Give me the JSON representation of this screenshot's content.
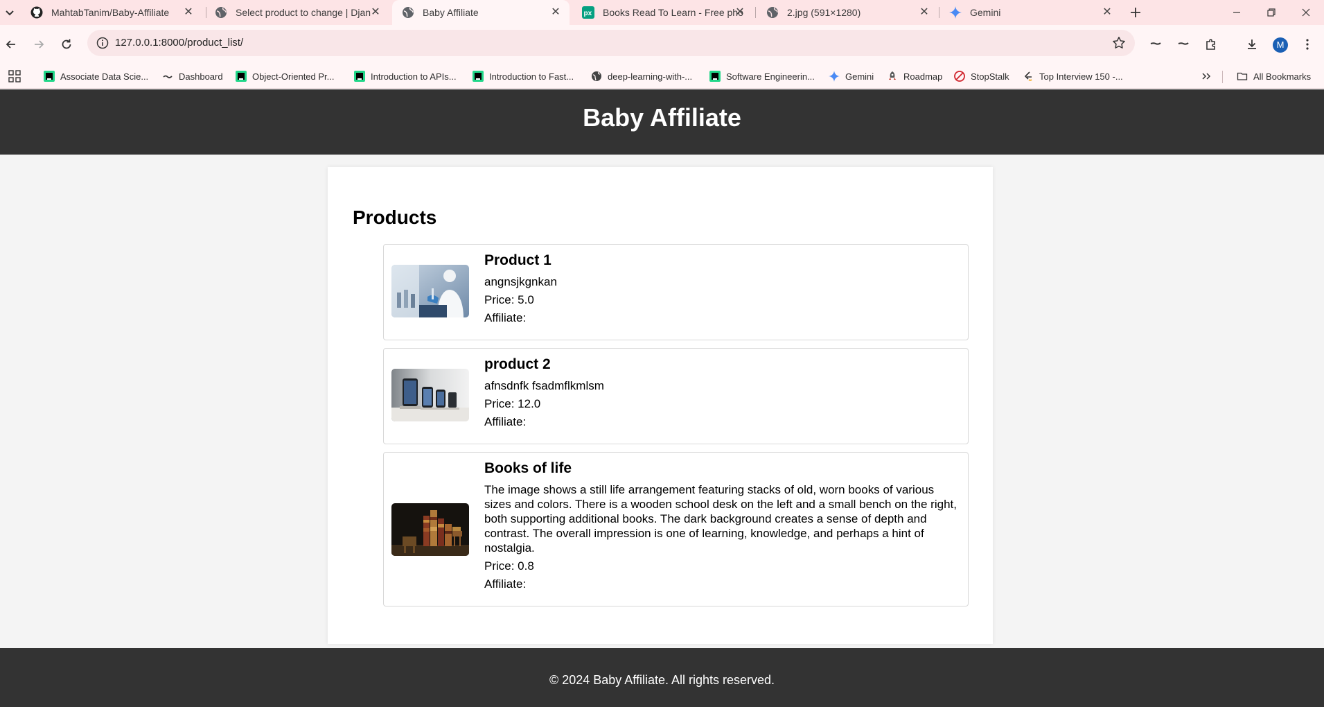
{
  "browser": {
    "tabs": [
      {
        "title": "MahtabTanim/Baby-Affiliate",
        "icon": "github-icon",
        "active": false
      },
      {
        "title": "Select product to change | Djan",
        "icon": "globe-icon",
        "active": false
      },
      {
        "title": "Baby Affiliate",
        "icon": "globe-icon",
        "active": true
      },
      {
        "title": "Books Read To Learn - Free pho",
        "icon": "pexels-icon",
        "active": false
      },
      {
        "title": "2.jpg (591×1280)",
        "icon": "globe-icon",
        "active": false
      },
      {
        "title": "Gemini",
        "icon": "gemini-icon",
        "active": false
      }
    ],
    "url": "127.0.0.1:8000/product_list/",
    "profile_initial": "M",
    "bookmarks": [
      {
        "label": "Associate Data Scie...",
        "icon": "pycharm-icon"
      },
      {
        "label": "Dashboard",
        "icon": "dashboard-icon"
      },
      {
        "label": "Object-Oriented Pr...",
        "icon": "pycharm-icon"
      },
      {
        "label": "Introduction to APIs...",
        "icon": "pycharm-icon"
      },
      {
        "label": "Introduction to Fast...",
        "icon": "pycharm-icon"
      },
      {
        "label": "deep-learning-with-...",
        "icon": "globe-icon"
      },
      {
        "label": "Software Engineerin...",
        "icon": "pycharm-icon"
      },
      {
        "label": "Gemini",
        "icon": "gemini-icon"
      },
      {
        "label": "Roadmap",
        "icon": "rocket-icon"
      },
      {
        "label": "StopStalk",
        "icon": "stopstalk-icon"
      },
      {
        "label": "Top Interview 150 -...",
        "icon": "leetcode-icon"
      }
    ],
    "all_bookmarks_label": "All Bookmarks"
  },
  "page": {
    "site_title": "Baby Affiliate",
    "section_title": "Products",
    "products": [
      {
        "name": "Product 1",
        "description": "angnsjkgnkan",
        "price": "Price: 5.0",
        "affiliate": "Affiliate:",
        "image": "lab-researcher-photo"
      },
      {
        "name": "product 2",
        "description": "afnsdnfk fsadmflkmlsm",
        "price": "Price: 12.0",
        "affiliate": "Affiliate:",
        "image": "smartphones-on-stands-photo"
      },
      {
        "name": "Books of life",
        "description": "The image shows a still life arrangement featuring stacks of old, worn books of various sizes and colors. There is a wooden school desk on the left and a small bench on the right, both supporting additional books. The dark background creates a sense of depth and contrast. The overall impression is one of learning, knowledge, and perhaps a hint of nostalgia.",
        "price": "Price: 0.8",
        "affiliate": "Affiliate:",
        "image": "stacked-books-photo"
      }
    ],
    "footer_text": "© 2024 Baby Affiliate. All rights reserved."
  },
  "colors": {
    "header_bg": "#333333",
    "page_bg": "#f4f4f4",
    "tabbar_bg": "#fde4e6"
  }
}
